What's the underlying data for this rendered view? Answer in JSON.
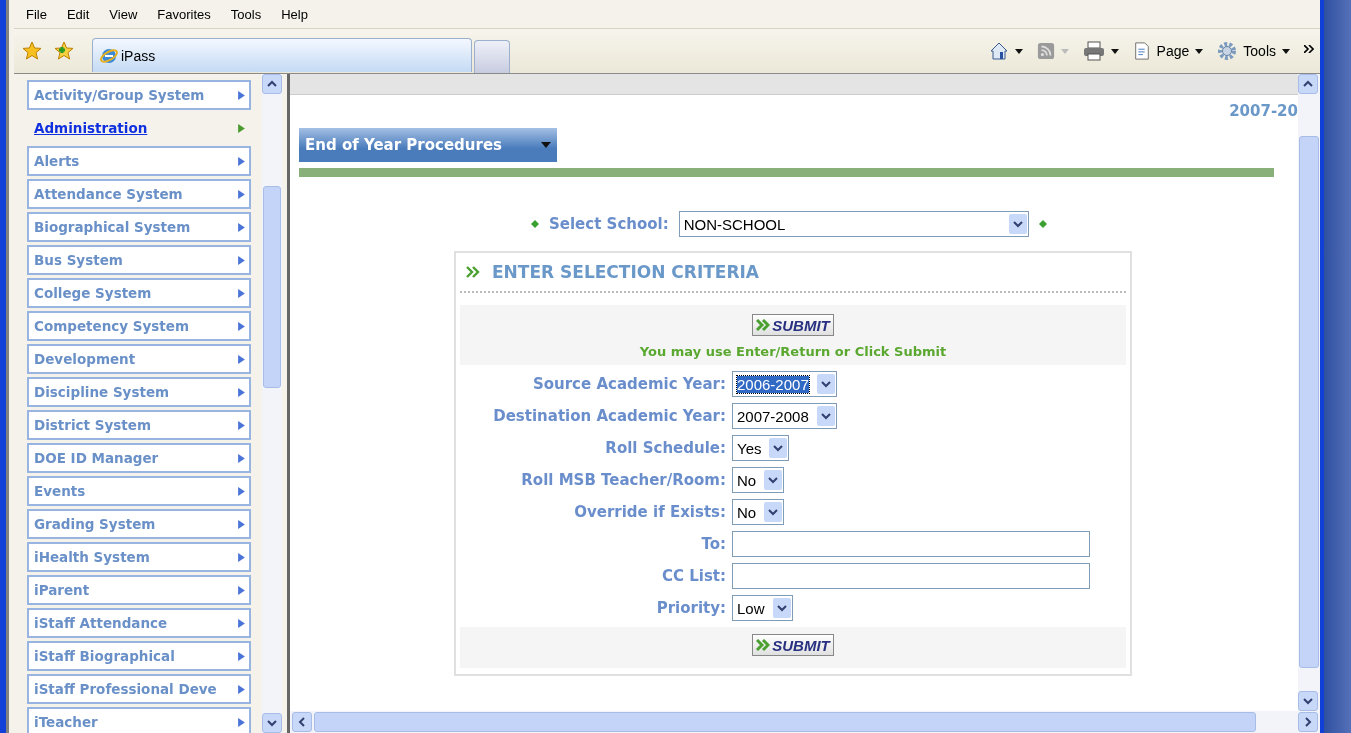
{
  "menu_bar": [
    "File",
    "Edit",
    "View",
    "Favorites",
    "Tools",
    "Help"
  ],
  "tab": {
    "title": "iPass"
  },
  "command_bar": [
    {
      "kind": "home"
    },
    {
      "kind": "feed"
    },
    {
      "kind": "print"
    },
    {
      "kind": "page",
      "label": "Page"
    },
    {
      "kind": "tools",
      "label": "Tools"
    }
  ],
  "sidebar": {
    "items": [
      {
        "label": "Activity/Group System",
        "selected": false
      },
      {
        "label": "Administration",
        "selected": true
      },
      {
        "label": "Alerts",
        "selected": false
      },
      {
        "label": "Attendance System",
        "selected": false
      },
      {
        "label": "Biographical System",
        "selected": false
      },
      {
        "label": "Bus System",
        "selected": false
      },
      {
        "label": "College System",
        "selected": false
      },
      {
        "label": "Competency System",
        "selected": false
      },
      {
        "label": "Development",
        "selected": false
      },
      {
        "label": "Discipline System",
        "selected": false
      },
      {
        "label": "District System",
        "selected": false
      },
      {
        "label": "DOE ID Manager",
        "selected": false
      },
      {
        "label": "Events",
        "selected": false
      },
      {
        "label": "Grading System",
        "selected": false
      },
      {
        "label": "iHealth System",
        "selected": false
      },
      {
        "label": "iParent",
        "selected": false
      },
      {
        "label": "iStaff Attendance",
        "selected": false
      },
      {
        "label": "iStaff Biographical",
        "selected": false
      },
      {
        "label": "iStaff Professional Deve",
        "selected": false
      },
      {
        "label": "iTeacher",
        "selected": false
      }
    ]
  },
  "year": "2007-20",
  "procedure_menu": "End of Year Procedures",
  "school": {
    "label": "Select School:",
    "value": "NON-SCHOOL"
  },
  "criteria": {
    "title": "ENTER SELECTION CRITERIA",
    "submit": "SUBMIT",
    "hint": "You may use Enter/Return or Click Submit",
    "fields": [
      {
        "kind": "select",
        "label": "Source Academic Year:",
        "value": "2006-2007",
        "focused": true
      },
      {
        "kind": "select",
        "label": "Destination Academic Year:",
        "value": "2007-2008",
        "focused": false
      },
      {
        "kind": "select",
        "label": "Roll Schedule:",
        "value": "Yes",
        "focused": false
      },
      {
        "kind": "select",
        "label": "Roll MSB Teacher/Room:",
        "value": "No",
        "focused": false
      },
      {
        "kind": "select",
        "label": "Override if Exists:",
        "value": "No",
        "focused": false
      },
      {
        "kind": "text",
        "label": "To:"
      },
      {
        "kind": "text",
        "label": "CC List:"
      },
      {
        "kind": "select",
        "label": "Priority:",
        "value": "Low",
        "focused": false
      }
    ],
    "submit_bottom": "SUBMIT"
  }
}
